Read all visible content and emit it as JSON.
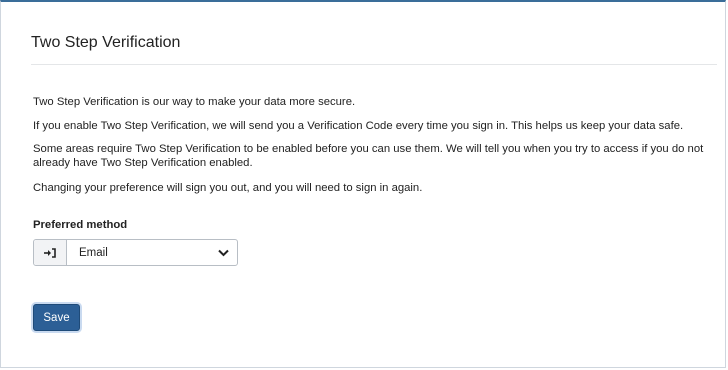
{
  "panel": {
    "title": "Two Step Verification"
  },
  "paragraphs": [
    "Two Step Verification is our way to make your data more secure.",
    "If you enable Two Step Verification, we will send you a Verification Code every time you sign in. This helps us keep your data safe.",
    "Some areas require Two Step Verification to be enabled before you can use them. We will tell you when you try to access if you do not already have Two Step Verification enabled.",
    "Changing your preference will sign you out, and you will need to sign in again."
  ],
  "preferred_method": {
    "label": "Preferred method",
    "selected": "Email",
    "addon_icon": "sign-in-arrow-icon",
    "dropdown_icon": "chevron-down-icon"
  },
  "actions": {
    "save_label": "Save"
  },
  "colors": {
    "primary_button": "#2c5f96",
    "top_border": "#3a6d99"
  }
}
